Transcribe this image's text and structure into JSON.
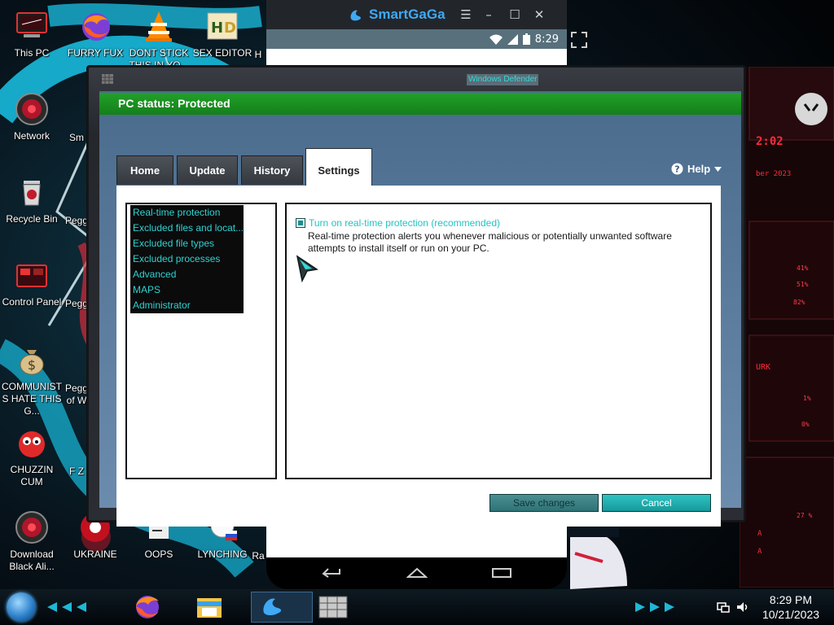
{
  "desktop": {
    "icons": [
      {
        "label": "This PC",
        "icon": "computer-icon"
      },
      {
        "label": "FURRY FUX",
        "icon": "firefox-icon"
      },
      {
        "label": "DONT STICK THIS IN YO...",
        "icon": "vlc-icon"
      },
      {
        "label": "SEX EDITOR",
        "icon": "hxd-icon"
      },
      {
        "label": "H",
        "icon": "partial-icon"
      },
      {
        "label": "Network",
        "icon": "network-orb-icon"
      },
      {
        "label": "Sm",
        "icon": "partial-icon"
      },
      {
        "label": "Recycle Bin",
        "icon": "recycle-bin-icon"
      },
      {
        "label": "Pegg",
        "icon": "partial-icon"
      },
      {
        "label": "Control Panel",
        "icon": "control-panel-icon"
      },
      {
        "label": "Pegg",
        "icon": "partial-icon"
      },
      {
        "label": "COMMUNISTS HATE THIS G...",
        "icon": "money-bag-icon"
      },
      {
        "label": "Pegg of W",
        "icon": "partial-icon"
      },
      {
        "label": "CHUZZIN CUM",
        "icon": "chuzzle-icon"
      },
      {
        "label": "F Z",
        "icon": "partial-icon"
      },
      {
        "label": "Download Black Ali...",
        "icon": "alienware-orb-icon"
      },
      {
        "label": "UKRAINE",
        "icon": "ukraine-shortcut-icon"
      },
      {
        "label": "OOPS",
        "icon": "oops-shortcut-icon"
      },
      {
        "label": "LYNCHING",
        "icon": "lynching-shortcut-icon"
      },
      {
        "label": "Ra",
        "icon": "partial-icon"
      }
    ]
  },
  "emulator": {
    "app_name": "SmartGaGa",
    "status_time": "8:29",
    "accent": "#3fa9f5"
  },
  "defender": {
    "window_title": "Windows Defender",
    "status_text": "PC status: Protected",
    "status_color": "#1c8f22",
    "tabs": [
      {
        "label": "Home"
      },
      {
        "label": "Update"
      },
      {
        "label": "History"
      },
      {
        "label": "Settings",
        "active": true
      }
    ],
    "help_label": "Help",
    "nav_items": [
      "Real-time protection",
      "Excluded files and locat...",
      "Excluded file types",
      "Excluded processes",
      "Advanced",
      "MAPS",
      "Administrator"
    ],
    "rtp_checkbox_label": "Turn on real-time protection (recommended)",
    "rtp_checked": true,
    "rtp_description": "Real-time protection alerts you whenever malicious or potentially unwanted software attempts to install itself or run on your PC.",
    "save_button": "Save changes",
    "cancel_button": "Cancel"
  },
  "taskbar": {
    "apps": [
      "firefox-icon",
      "file-explorer-icon",
      "smartgaga-icon",
      "defender-icon"
    ],
    "clock_time": "8:29 PM",
    "clock_date": "10/21/2023"
  }
}
